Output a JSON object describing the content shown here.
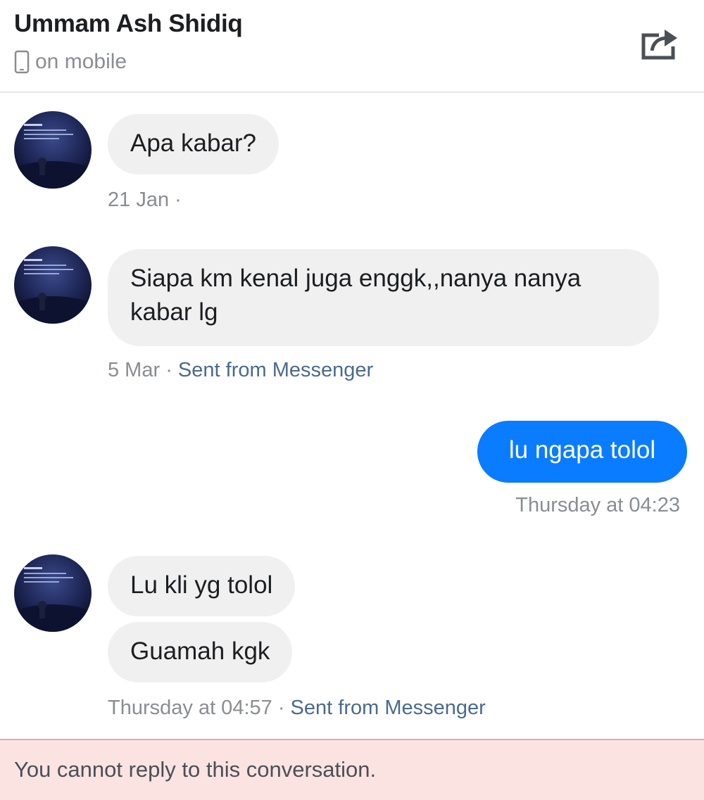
{
  "header": {
    "contact_name": "Ummam Ash Shidiq",
    "status": "on mobile",
    "status_icon": "mobile-phone-icon",
    "share_icon": "share-icon"
  },
  "thread": {
    "messages": [
      {
        "direction": "received",
        "text": "Apa kabar?"
      },
      {
        "direction": "received",
        "text": "Siapa km kenal juga enggk,,nanya nanya\nkabar lg"
      },
      {
        "direction": "sent",
        "text": "lu ngapa tolol"
      },
      {
        "direction": "received",
        "text": "Lu kli yg tolol"
      },
      {
        "direction": "received",
        "text": "Guamah kgk"
      }
    ],
    "meta": [
      {
        "time": "21 Jan",
        "separator": " ·",
        "source": ""
      },
      {
        "time": "5 Mar",
        "separator": " · ",
        "source": "Sent from Messenger"
      },
      {
        "time": "Thursday at 04:23",
        "separator": "",
        "source": ""
      },
      {
        "time": "Thursday at 04:57",
        "separator": " · ",
        "source": "Sent from Messenger"
      }
    ]
  },
  "footer": {
    "notice": "You cannot reply to this conversation."
  },
  "colors": {
    "sent_bubble": "#0a7cff",
    "received_bubble": "#f0f0f0",
    "notice_background": "#fbe3e2"
  }
}
